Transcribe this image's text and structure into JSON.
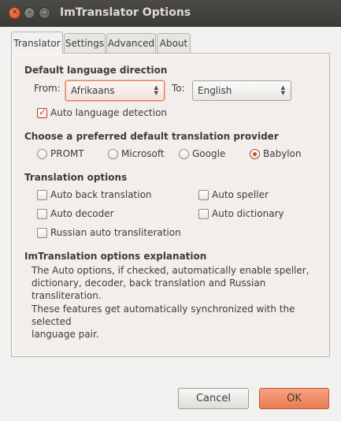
{
  "window": {
    "title": "ImTranslator Options"
  },
  "tabs": [
    {
      "label": "Translator",
      "active": true
    },
    {
      "label": "Settings",
      "active": false
    },
    {
      "label": "Advanced",
      "active": false
    },
    {
      "label": "About",
      "active": false
    }
  ],
  "language_direction": {
    "heading": "Default language direction",
    "from_label": "From:",
    "from_value": "Afrikaans",
    "to_label": "To:",
    "to_value": "English",
    "auto_detect": {
      "label": "Auto language detection",
      "checked": true
    }
  },
  "provider": {
    "heading": "Choose a preferred default translation provider",
    "options": [
      {
        "label": "PROMT",
        "selected": false
      },
      {
        "label": "Microsoft",
        "selected": false
      },
      {
        "label": "Google",
        "selected": false
      },
      {
        "label": "Babylon",
        "selected": true
      }
    ]
  },
  "translation_options": {
    "heading": "Translation options",
    "items": [
      {
        "label": "Auto back translation",
        "checked": false
      },
      {
        "label": "Auto speller",
        "checked": false
      },
      {
        "label": "Auto decoder",
        "checked": false
      },
      {
        "label": "Auto dictionary",
        "checked": false
      },
      {
        "label": "Russian auto transliteration",
        "checked": false
      }
    ]
  },
  "explanation": {
    "heading": "ImTranslation options explanation",
    "lines": [
      "The Auto options, if checked, automatically enable speller,",
      "dictionary, decoder, back translation and Russian transliteration.",
      "These features get automatically synchronized with the selected",
      "language pair."
    ]
  },
  "buttons": {
    "cancel": "Cancel",
    "ok": "OK"
  },
  "colors": {
    "accent": "#ea7a50",
    "titlebar": "#3c3b37",
    "panel_bg": "#f2eeec"
  }
}
